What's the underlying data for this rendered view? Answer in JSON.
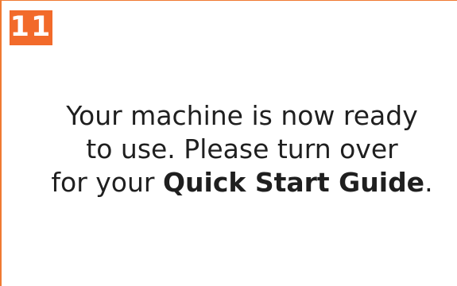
{
  "step": {
    "number": "11"
  },
  "message": {
    "line1": "Your machine is now ready",
    "line2": "to use. Please turn over",
    "line3_prefix": "for your ",
    "line3_bold": "Quick Start Guide",
    "line3_suffix": "."
  },
  "colors": {
    "accent": "#f26a2a",
    "border": "#f07a32",
    "text": "#1f1f1f"
  }
}
